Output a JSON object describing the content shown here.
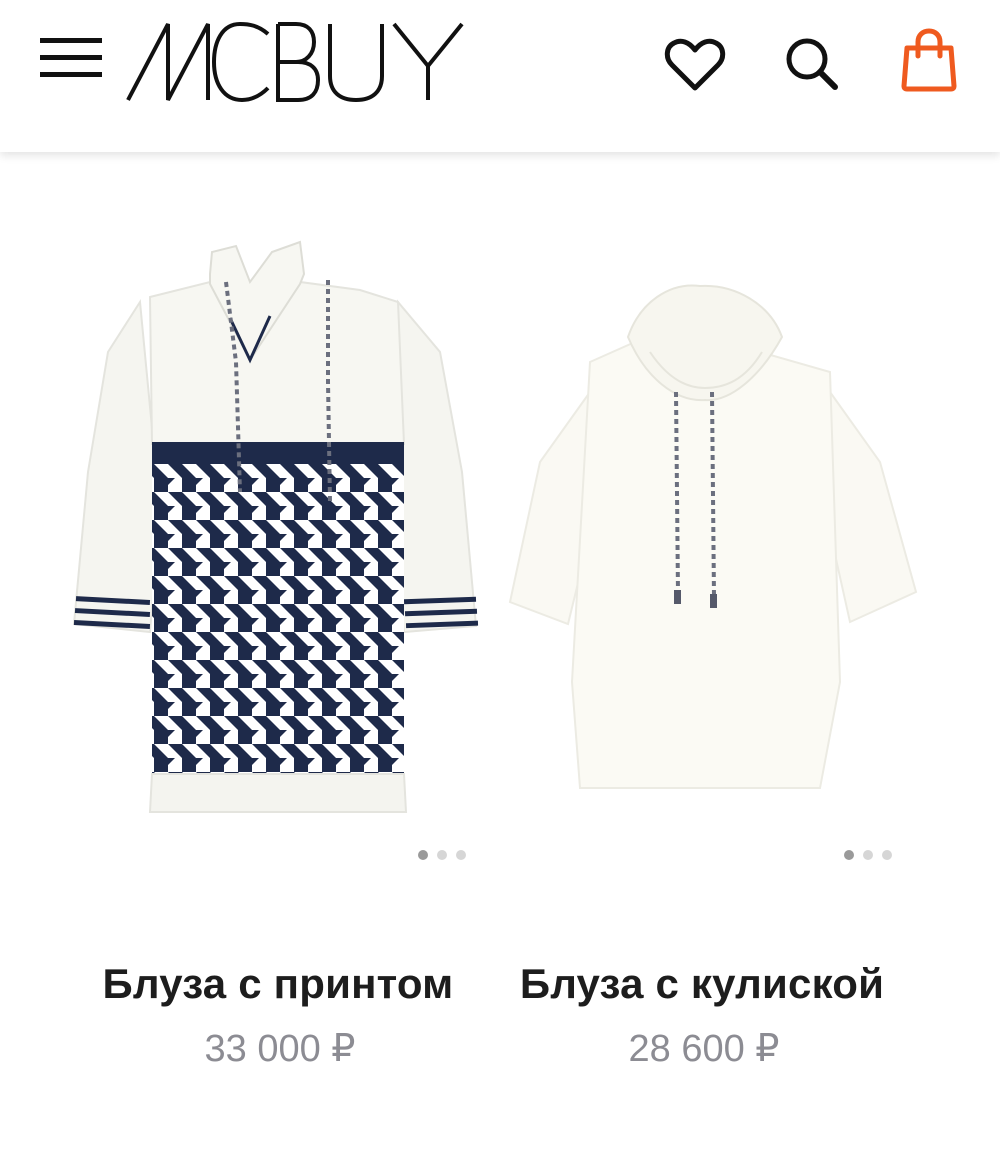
{
  "header": {
    "logo_text": "MCBUY",
    "menu_icon": "hamburger-icon",
    "favorites_icon": "heart-icon",
    "search_icon": "search-icon",
    "cart_icon": "shopping-bag-icon",
    "cart_color": "#ef5a1f"
  },
  "products": [
    {
      "title": "Блуза с принтом",
      "price": "33 000 ₽",
      "image": "white-blouse-navy-geometric-print",
      "slides": 3,
      "active_slide": 1
    },
    {
      "title": "Блуза с кулиской",
      "price": "28 600 ₽",
      "image": "white-blouse-drawstring-collar",
      "slides": 3,
      "active_slide": 1
    }
  ]
}
